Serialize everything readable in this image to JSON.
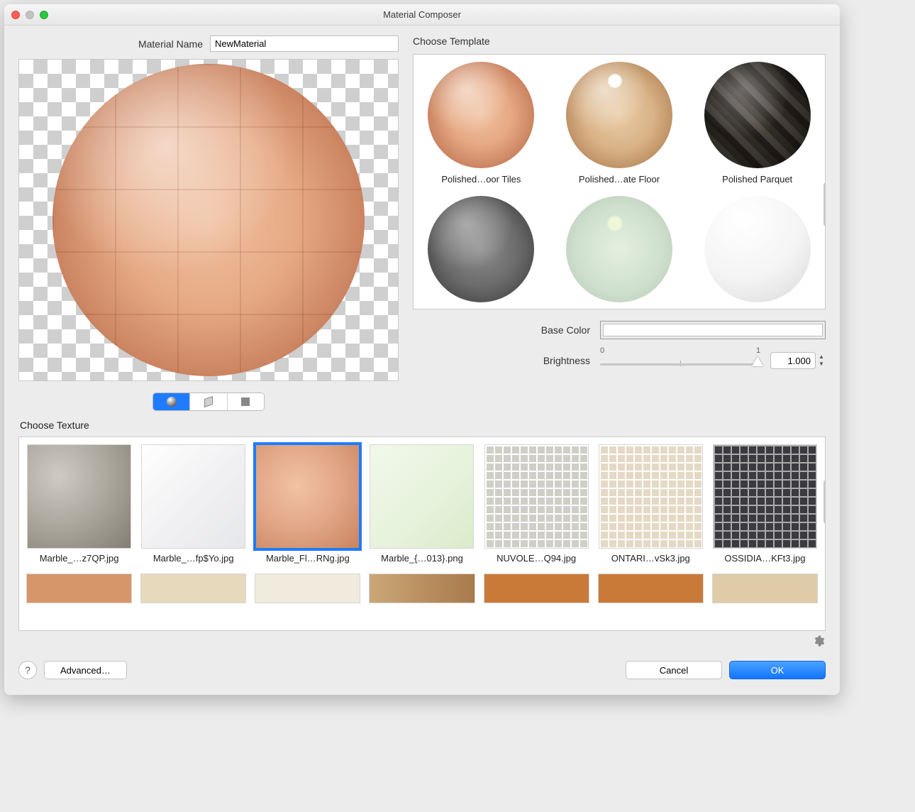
{
  "window": {
    "title": "Material Composer"
  },
  "material": {
    "name_label": "Material Name",
    "name_value": "NewMaterial"
  },
  "sections": {
    "choose_template": "Choose Template",
    "choose_texture": "Choose Texture"
  },
  "templates": [
    {
      "label": "Polished…oor Tiles",
      "style": "ball-tiles"
    },
    {
      "label": "Polished…ate Floor",
      "style": "ball-laminate"
    },
    {
      "label": "Polished Parquet",
      "style": "ball-parquet"
    },
    {
      "label": "",
      "style": "ball-granular"
    },
    {
      "label": "",
      "style": "ball-frosted"
    },
    {
      "label": "",
      "style": "ball-white"
    }
  ],
  "params": {
    "base_color_label": "Base Color",
    "base_color_value": "#ffffff",
    "brightness_label": "Brightness",
    "brightness_min_label": "0",
    "brightness_max_label": "1",
    "brightness_value": "1.000"
  },
  "textures": {
    "row1": [
      {
        "label": "Marble_…z7QP.jpg",
        "cls": "th-marble-grey",
        "selected": false
      },
      {
        "label": "Marble_…fp$Yo.jpg",
        "cls": "th-marble-white",
        "selected": false
      },
      {
        "label": "Marble_Fl…RNg.jpg",
        "cls": "th-marble-peach",
        "selected": true
      },
      {
        "label": "Marble_{…013}.png",
        "cls": "th-marble-green",
        "selected": false
      },
      {
        "label": "NUVOLE…Q94.jpg",
        "cls": "th-mosaic-grey",
        "selected": false
      },
      {
        "label": "ONTARI…vSk3.jpg",
        "cls": "th-mosaic-beige",
        "selected": false
      },
      {
        "label": "OSSIDIA…KFt3.jpg",
        "cls": "th-mosaic-dark",
        "selected": false
      }
    ]
  },
  "footer": {
    "help": "?",
    "advanced": "Advanced…",
    "cancel": "Cancel",
    "ok": "OK"
  }
}
